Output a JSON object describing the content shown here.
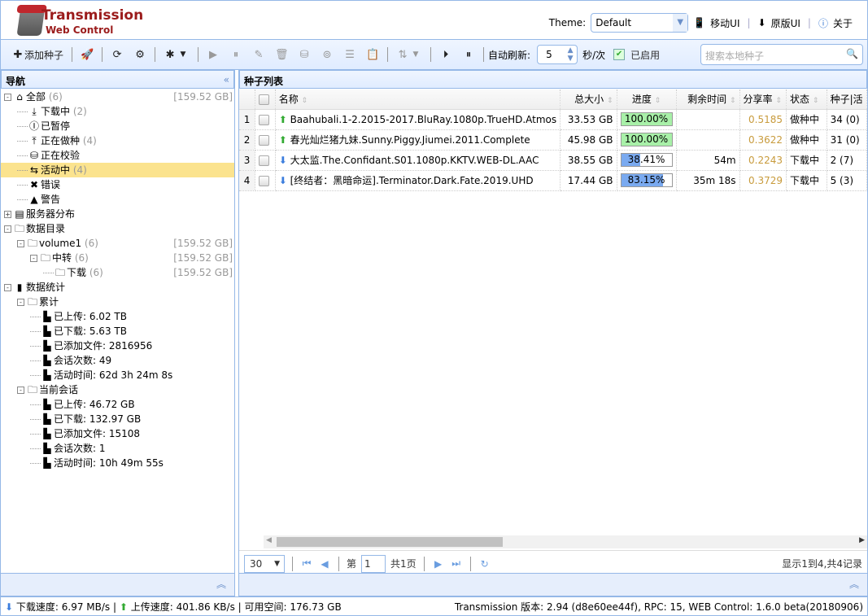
{
  "header": {
    "title": "Transmission",
    "subtitle": "Web Control",
    "theme_label": "Theme:",
    "theme_value": "Default",
    "mobile_ui": "移动UI",
    "original_ui": "原版UI",
    "about": "关于"
  },
  "toolbar": {
    "add_torrent": "添加种子",
    "auto_refresh_label": "自动刷新:",
    "refresh_interval": "5",
    "interval_unit": "秒/次",
    "enabled_label": "已启用",
    "enabled": true,
    "search_placeholder": "搜索本地种子"
  },
  "nav": {
    "title": "导航",
    "collapse_icon": "double-chevron-left-icon",
    "items": [
      {
        "label": "全部",
        "count": "(6)",
        "size": "[159.52 GB]",
        "icon": "home-icon",
        "level": 0,
        "toggle": "-"
      },
      {
        "label": "下载中",
        "count": "(2)",
        "icon": "download-icon",
        "level": 1
      },
      {
        "label": "已暂停",
        "count": "",
        "icon": "pause-circle-icon",
        "level": 1
      },
      {
        "label": "正在做种",
        "count": "(4)",
        "icon": "upload-icon",
        "level": 1
      },
      {
        "label": "正在校验",
        "count": "",
        "icon": "database-search-icon",
        "level": 1
      },
      {
        "label": "活动中",
        "count": "(4)",
        "icon": "exchange-icon",
        "level": 1,
        "selected": true
      },
      {
        "label": "错误",
        "count": "",
        "icon": "error-icon",
        "level": 1
      },
      {
        "label": "警告",
        "count": "",
        "icon": "warning-icon",
        "level": 1
      },
      {
        "label": "服务器分布",
        "count": "",
        "icon": "server-icon",
        "level": 0,
        "toggle": "+"
      },
      {
        "label": "数据目录",
        "count": "",
        "icon": "folder-icon",
        "level": 0,
        "toggle": "-"
      },
      {
        "label": "volume1",
        "count": "(6)",
        "size": "[159.52 GB]",
        "icon": "folder-icon",
        "level": 1,
        "toggle": "-"
      },
      {
        "label": "中转",
        "count": "(6)",
        "size": "[159.52 GB]",
        "icon": "folder-icon",
        "level": 2,
        "toggle": "-"
      },
      {
        "label": "下载",
        "count": "(6)",
        "size": "[159.52 GB]",
        "icon": "folder-icon",
        "level": 3
      },
      {
        "label": "数据统计",
        "count": "",
        "icon": "bar-chart-icon",
        "level": 0,
        "toggle": "-"
      },
      {
        "label": "累计",
        "count": "",
        "icon": "folder-icon",
        "level": 1,
        "toggle": "-"
      },
      {
        "label": "已上传:  6.02 TB",
        "count": "",
        "icon": "file-icon",
        "level": 2
      },
      {
        "label": "已下载:  5.63 TB",
        "count": "",
        "icon": "file-icon",
        "level": 2
      },
      {
        "label": "已添加文件:  2816956",
        "count": "",
        "icon": "file-icon",
        "level": 2
      },
      {
        "label": "会话次数:  49",
        "count": "",
        "icon": "file-icon",
        "level": 2
      },
      {
        "label": "活动时间:  62d 3h 24m 8s",
        "count": "",
        "icon": "file-icon",
        "level": 2
      },
      {
        "label": "当前会话",
        "count": "",
        "icon": "folder-icon",
        "level": 1,
        "toggle": "-"
      },
      {
        "label": "已上传:  46.72 GB",
        "count": "",
        "icon": "file-icon",
        "level": 2
      },
      {
        "label": "已下载:  132.97 GB",
        "count": "",
        "icon": "file-icon",
        "level": 2
      },
      {
        "label": "已添加文件:  15108",
        "count": "",
        "icon": "file-icon",
        "level": 2
      },
      {
        "label": "会话次数:  1",
        "count": "",
        "icon": "file-icon",
        "level": 2
      },
      {
        "label": "活动时间:  10h 49m 55s",
        "count": "",
        "icon": "file-icon",
        "level": 2
      }
    ]
  },
  "list": {
    "title": "种子列表",
    "columns": [
      "名称",
      "总大小",
      "进度",
      "剩余时间",
      "分享率",
      "状态",
      "种子|活"
    ],
    "rows": [
      {
        "n": "1",
        "dir": "up",
        "name": "Baahubali.1-2.2015-2017.BluRay.1080p.TrueHD.Atmos",
        "size": "33.53 GB",
        "progress": 100,
        "progress_text": "100.00%",
        "remaining": "",
        "ratio": "0.5185",
        "status": "做种中",
        "seeds": "34 (0)"
      },
      {
        "n": "2",
        "dir": "up",
        "name": "春光灿烂猪九妹.Sunny.Piggy.Jiumei.2011.Complete",
        "size": "45.98 GB",
        "progress": 100,
        "progress_text": "100.00%",
        "remaining": "",
        "ratio": "0.3622",
        "status": "做种中",
        "seeds": "31 (0)"
      },
      {
        "n": "3",
        "dir": "down",
        "name": "大太监.The.Confidant.S01.1080p.KKTV.WEB-DL.AAC",
        "size": "38.55 GB",
        "progress": 38.41,
        "progress_text": "38.41%",
        "remaining": "54m",
        "ratio": "0.2243",
        "status": "下载中",
        "seeds": "2 (7)"
      },
      {
        "n": "4",
        "dir": "down",
        "name": "[终结者：黑暗命运].Terminator.Dark.Fate.2019.UHD",
        "size": "17.44 GB",
        "progress": 83.15,
        "progress_text": "83.15%",
        "remaining": "35m 18s",
        "ratio": "0.3729",
        "status": "下载中",
        "seeds": "5 (3)"
      }
    ],
    "pager": {
      "page_size": "30",
      "page_prefix": "第",
      "page": "1",
      "page_suffix": "共1页",
      "summary": "显示1到4,共4记录"
    }
  },
  "status": {
    "dl_label": "下载速度:",
    "dl": "6.97 MB/s",
    "ul_label": "上传速度:",
    "ul": "401.86 KB/s",
    "free_label": "可用空间:",
    "free": "176.73 GB",
    "version": "Transmission 版本: 2.94 (d8e60ee44f), RPC: 15, WEB Control: 1.6.0 beta(20180906)"
  },
  "colors": {
    "accent": "#95b8e7",
    "title": "#9b1c1c",
    "done": "#a8f0a8",
    "downloading": "#7aaaf0",
    "ratio": "#c89b3c",
    "selected": "#fbe38e"
  }
}
